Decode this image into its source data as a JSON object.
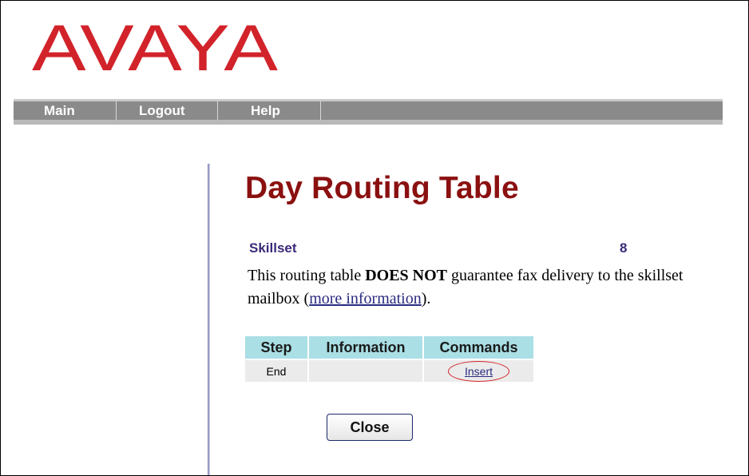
{
  "logo": {
    "text": "AVAYA",
    "color": "#d2232a"
  },
  "nav": {
    "items": [
      {
        "label": "Main"
      },
      {
        "label": "Logout"
      },
      {
        "label": "Help"
      }
    ]
  },
  "page": {
    "title": "Day Routing Table",
    "skillset_label": "Skillset",
    "skillset_value": "8",
    "notice": {
      "prefix": "This routing table ",
      "emphasis": "DOES NOT",
      "middle": " guarantee fax delivery to the skillset mailbox (",
      "link": "more information",
      "suffix": ")."
    }
  },
  "table": {
    "headers": [
      "Step",
      "Information",
      "Commands"
    ],
    "rows": [
      {
        "step": "End",
        "information": "",
        "command": "Insert"
      }
    ]
  },
  "buttons": {
    "close": "Close"
  },
  "colors": {
    "title": "#8b1010",
    "label": "#3b2a78",
    "nav_bg": "#8a8a8a",
    "table_header_bg": "#a9dfe5",
    "table_row_bg": "#ebebeb",
    "annotation": "#d2232a"
  }
}
